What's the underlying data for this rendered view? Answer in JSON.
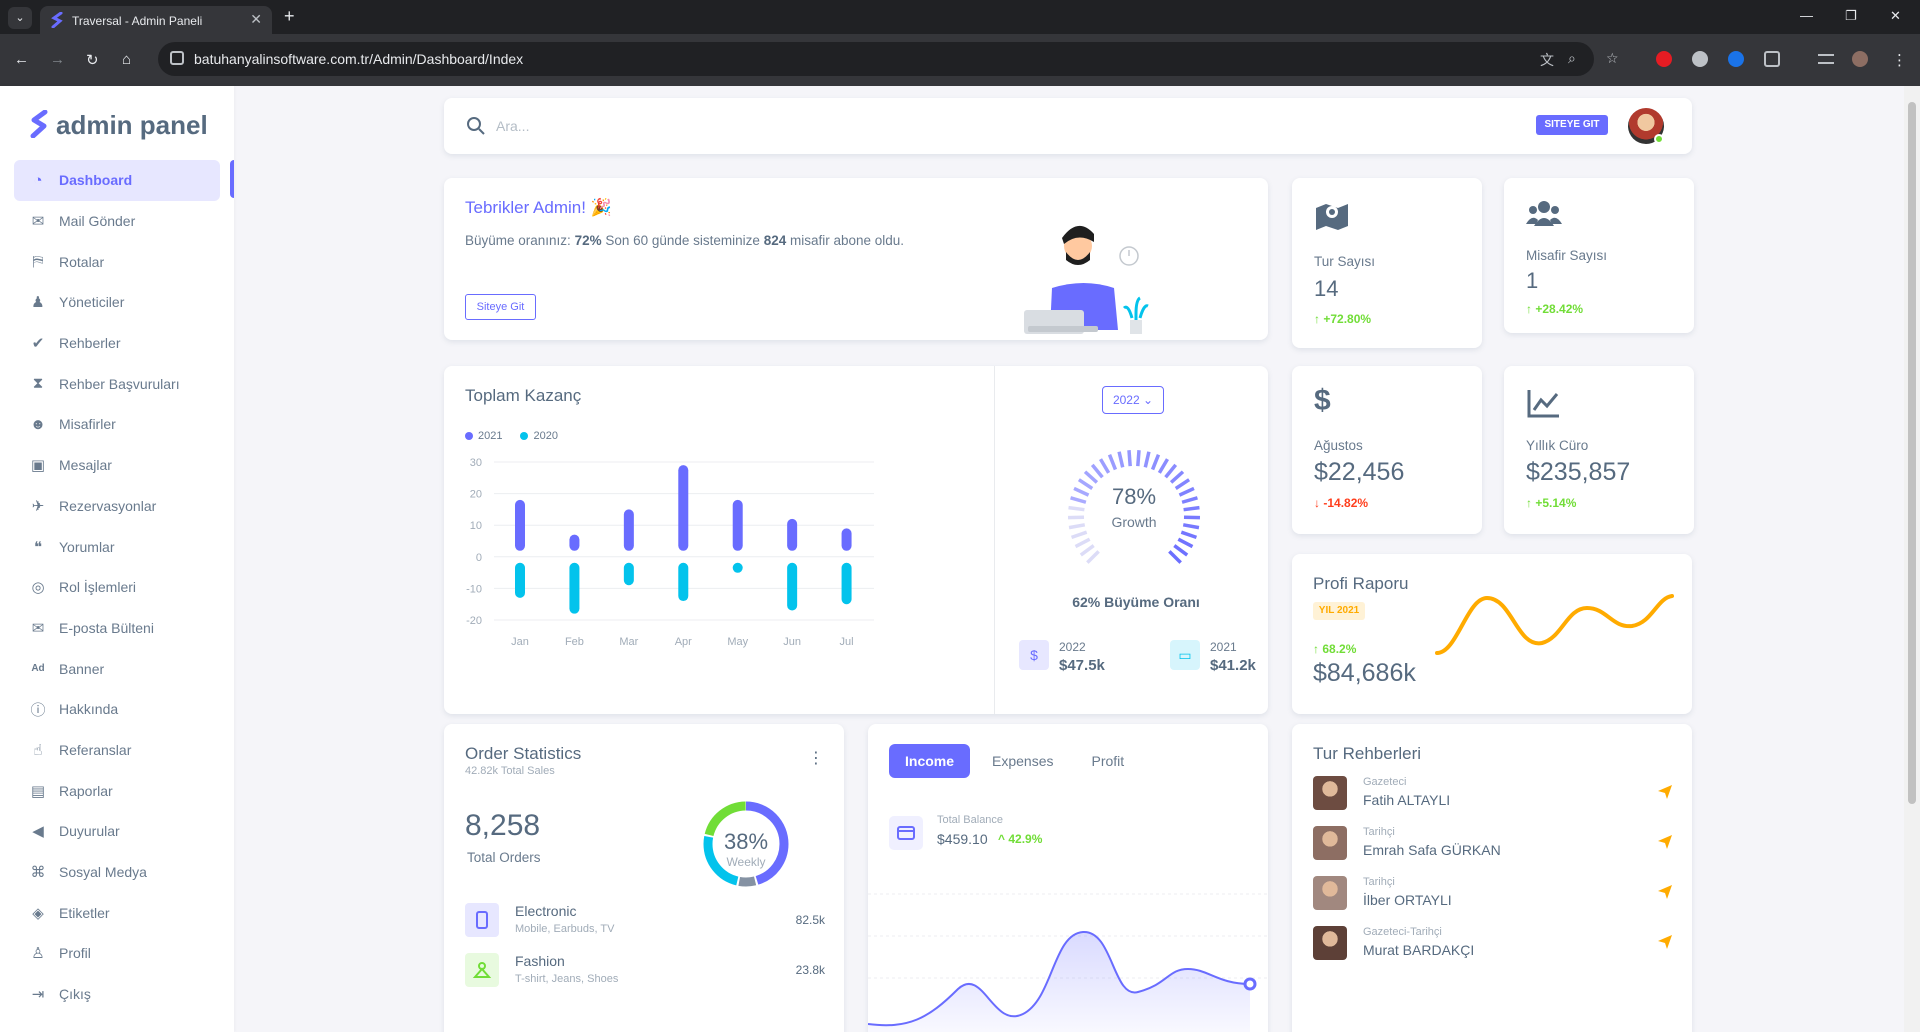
{
  "browser": {
    "tab_title": "Traversal - Admin Paneli",
    "url": "batuhanyalinsoftware.com.tr/Admin/Dashboard/Index"
  },
  "brand": {
    "name": "admin panel",
    "color": "#696cff"
  },
  "sidebar": {
    "items": [
      {
        "label": "Dashboard",
        "icon": "dashboard-icon",
        "active": true
      },
      {
        "label": "Mail Gönder",
        "icon": "mail-send-icon"
      },
      {
        "label": "Rotalar",
        "icon": "map-icon"
      },
      {
        "label": "Yöneticiler",
        "icon": "user-tie-icon"
      },
      {
        "label": "Rehberler",
        "icon": "user-check-icon"
      },
      {
        "label": "Rehber Başvuruları",
        "icon": "hourglass-icon"
      },
      {
        "label": "Misafirler",
        "icon": "users-icon"
      },
      {
        "label": "Mesajlar",
        "icon": "inbox-icon"
      },
      {
        "label": "Rezervasyonlar",
        "icon": "plane-icon"
      },
      {
        "label": "Yorumlar",
        "icon": "comments-icon"
      },
      {
        "label": "Rol İşlemleri",
        "icon": "fingerprint-icon"
      },
      {
        "label": "E-posta Bülteni",
        "icon": "envelope-icon"
      },
      {
        "label": "Banner",
        "icon": "ad-icon"
      },
      {
        "label": "Hakkında",
        "icon": "info-icon"
      },
      {
        "label": "Referanslar",
        "icon": "thumbs-up-icon"
      },
      {
        "label": "Raporlar",
        "icon": "pdf-icon"
      },
      {
        "label": "Duyurular",
        "icon": "megaphone-icon"
      },
      {
        "label": "Sosyal Medya",
        "icon": "social-icon"
      },
      {
        "label": "Etiketler",
        "icon": "tags-icon"
      },
      {
        "label": "Profil",
        "icon": "user-icon"
      },
      {
        "label": "Çıkış",
        "icon": "logout-icon"
      }
    ]
  },
  "navbar": {
    "search_placeholder": "Ara...",
    "site_button": "SITEYE GIT"
  },
  "welcome": {
    "title": "Tebrikler Admin! 🎉",
    "text_1": "Büyüme oranınız: ",
    "rate": "72%",
    "text_2": " Son 60 günde sisteminize ",
    "count": "824",
    "text_3": " misafir abone oldu.",
    "button": "Siteye Git"
  },
  "stats": {
    "tour": {
      "label": "Tur Sayısı",
      "value": "14",
      "delta": "+72.80%"
    },
    "guest": {
      "label": "Misafir Sayısı",
      "value": "1",
      "delta": "+28.42%"
    },
    "august": {
      "label": "Ağustos",
      "value": "$22,456",
      "delta": "-14.82%"
    },
    "yearly": {
      "label": "Yıllık Cüro",
      "value": "$235,857",
      "delta": "+5.14%"
    }
  },
  "revenue": {
    "title": "Toplam Kazanç",
    "year_select": "2022",
    "growth_pct": "78%",
    "growth_label": "Growth",
    "growth_rate": "62% Büyüme Oranı",
    "mini": [
      {
        "year": "2022",
        "value": "$47.5k"
      },
      {
        "year": "2021",
        "value": "$41.2k"
      }
    ]
  },
  "chart_data": {
    "type": "bar",
    "categories": [
      "Jan",
      "Feb",
      "Mar",
      "Apr",
      "May",
      "Jun",
      "Jul"
    ],
    "series": [
      {
        "name": "2021",
        "values": [
          18,
          7,
          15,
          29,
          18,
          12,
          9
        ],
        "color": "#696cff"
      },
      {
        "name": "2020",
        "values": [
          -13,
          -18,
          -9,
          -14,
          -5,
          -17,
          -15
        ],
        "color": "#03c3ec"
      }
    ],
    "ylim": [
      -20,
      30
    ],
    "yticks": [
      30,
      20,
      10,
      0,
      -10,
      -20
    ],
    "legend": "top-left",
    "grid": true
  },
  "growth_gauge": {
    "value": 78
  },
  "profile_report": {
    "title": "Profi Raporu",
    "badge": "YIL 2021",
    "delta": "68.2%",
    "value": "$84,686k"
  },
  "orders": {
    "title": "Order Statistics",
    "subtitle": "42.82k Total Sales",
    "total": "8,258",
    "total_label": "Total Orders",
    "donut_pct": "38%",
    "donut_label": "Weekly",
    "items": [
      {
        "name": "Electronic",
        "sub": "Mobile, Earbuds, TV",
        "value": "82.5k",
        "color": "#696cff",
        "bg": "#e7e7ff"
      },
      {
        "name": "Fashion",
        "sub": "T-shirt, Jeans, Shoes",
        "value": "23.8k",
        "color": "#71dd37",
        "bg": "#e8fadf"
      }
    ]
  },
  "income": {
    "tabs": [
      "Income",
      "Expenses",
      "Profit"
    ],
    "balance_label": "Total Balance",
    "balance_value": "$459.10",
    "balance_delta": "42.9%"
  },
  "guides": {
    "title": "Tur Rehberleri",
    "items": [
      {
        "role": "Gazeteci",
        "name": "Fatih ALTAYLI"
      },
      {
        "role": "Tarihçi",
        "name": "Emrah Safa GÜRKAN"
      },
      {
        "role": "Tarihçi",
        "name": "İlber ORTAYLI"
      },
      {
        "role": "Gazeteci-Tarihçi",
        "name": "Murat BARDAKÇI"
      }
    ]
  }
}
